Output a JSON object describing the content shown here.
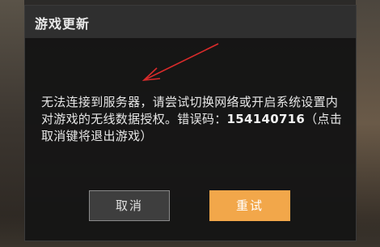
{
  "dialog": {
    "title": "游戏更新",
    "message_prefix": "无法连接到服务器，请尝试切换网络或开启系统设置内对游戏的无线数据授权。错误码：",
    "error_code": "154140716",
    "message_suffix": "（点击取消键将退出游戏）",
    "cancel_label": "取消",
    "retry_label": "重试"
  },
  "colors": {
    "accent": "#f2a74a",
    "annotation_arrow": "#d92b2b"
  },
  "icons": {
    "annotation": "red-arrow-icon"
  }
}
